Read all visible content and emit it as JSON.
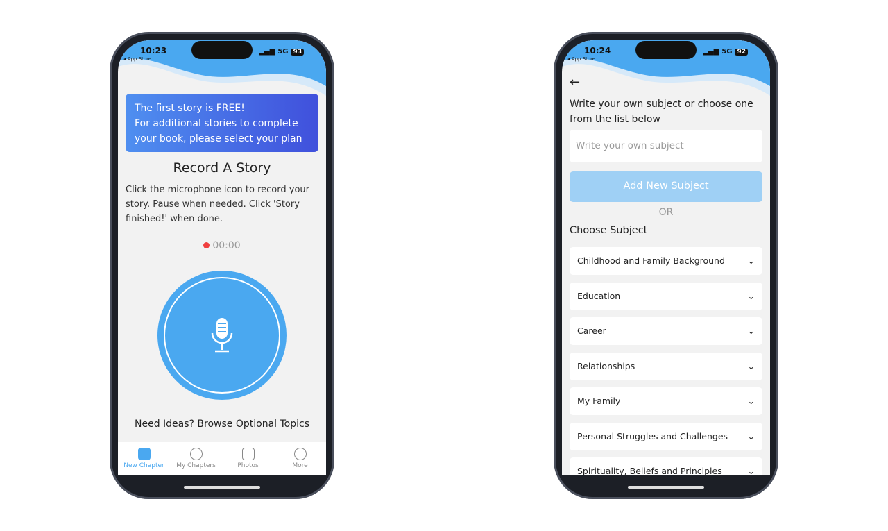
{
  "left": {
    "time": "10:23",
    "back_app": "◂ App Store",
    "network": "5G",
    "battery": "93",
    "banner": [
      "The first story is FREE!",
      "For additional stories to complete",
      "your book, please select your plan"
    ],
    "title": "Record A Story",
    "instructions": "Click the microphone icon to record your story. Pause when needed. Click 'Story finished!' when done.",
    "timer": "00:00",
    "ideas": "Need Ideas? Browse Optional Topics",
    "tabs": [
      {
        "label": "New Chapter",
        "active": true
      },
      {
        "label": "My Chapters"
      },
      {
        "label": "Photos"
      },
      {
        "label": "More"
      }
    ],
    "colors": {
      "accent": "#4aa8f0",
      "record": "#f04040"
    }
  },
  "right": {
    "time": "10:24",
    "back_app": "◂ App Store",
    "network": "5G",
    "battery": "92",
    "heading": "Write your own subject or choose one from the list below",
    "placeholder": "Write your own subject",
    "add_button": "Add New Subject",
    "or": "OR",
    "choose": "Choose Subject",
    "subjects": [
      "Childhood and Family Background",
      "Education",
      "Career",
      "Relationships",
      "My Family",
      "Personal Struggles and Challenges",
      "Spirituality, Beliefs and Principles"
    ]
  }
}
